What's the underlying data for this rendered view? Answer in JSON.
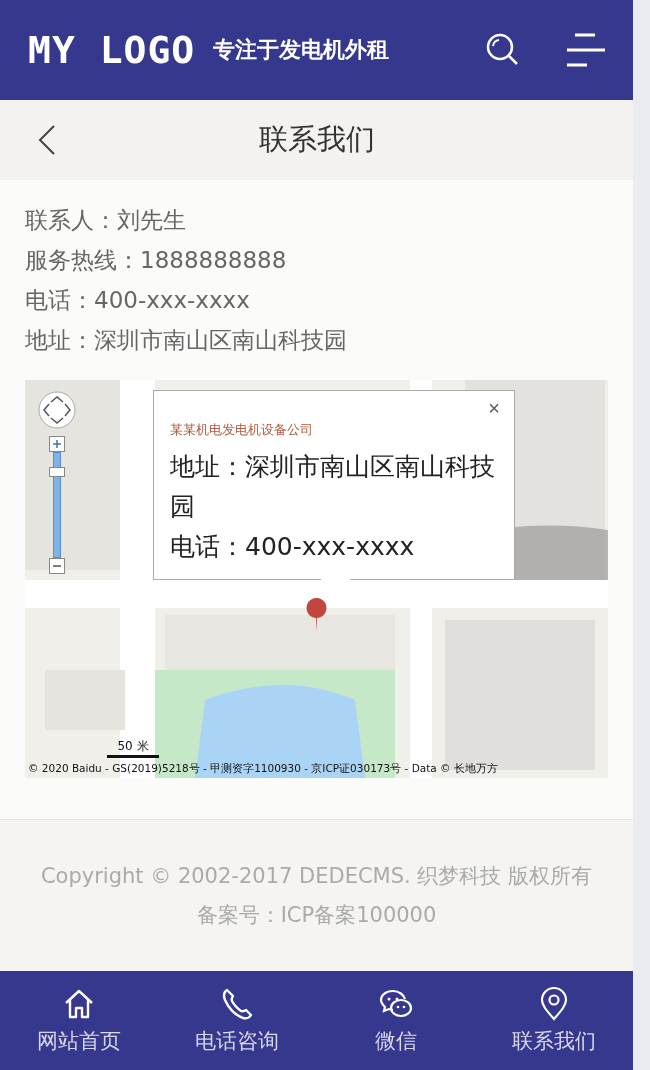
{
  "header": {
    "logo": "MY LOGO",
    "slogan": "专注于发电机外租"
  },
  "page_title": "联系我们",
  "contact": [
    "联系人：刘先生",
    "服务热线：1888888888",
    "电话：400-xxx-xxxx",
    "地址：深圳市南山区南山科技园"
  ],
  "map": {
    "popup": {
      "title": "某某机电发电机设备公司",
      "close": "×",
      "lines": [
        "地址：深圳市南山区南山科技园",
        "电话：400-xxx-xxxx"
      ]
    },
    "zoom": {
      "level": 0.82
    },
    "scale": "50 米",
    "copyright": "© 2020 Baidu - GS(2019)5218号 - 甲测资字1100930 - 京ICP证030173号 - Data © 长地万方"
  },
  "footer": {
    "copyright": "Copyright © 2002-2017 DEDECMS. 织梦科技 版权所有",
    "icp": "备案号：ICP备案100000"
  },
  "nav": [
    {
      "kind": "home",
      "label": "网站首页"
    },
    {
      "kind": "phone",
      "label": "电话咨询"
    },
    {
      "kind": "chat",
      "label": "微信"
    },
    {
      "kind": "pin",
      "label": "联系我们"
    }
  ]
}
